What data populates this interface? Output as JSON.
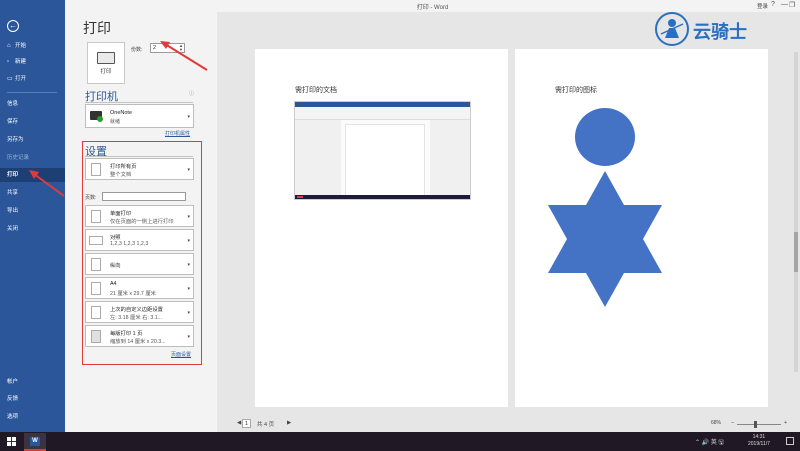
{
  "window": {
    "title": "打印 - Word",
    "login": "登录",
    "controls": [
      "?",
      "—",
      "❐",
      "✕"
    ]
  },
  "sidebar": {
    "back_glyph": "←",
    "items": [
      {
        "label": "开始",
        "icon": "home-icon",
        "glyph": "⌂"
      },
      {
        "label": "新建",
        "icon": "new-doc-icon",
        "glyph": "▫"
      },
      {
        "label": "打开",
        "icon": "open-folder-icon",
        "glyph": "▭"
      },
      {
        "label": "信息"
      },
      {
        "label": "保存"
      },
      {
        "label": "另存为"
      },
      {
        "label": "历史记录"
      },
      {
        "label": "打印"
      },
      {
        "label": "共享"
      },
      {
        "label": "导出"
      },
      {
        "label": "关闭"
      },
      {
        "label": "帐户"
      },
      {
        "label": "反馈"
      },
      {
        "label": "选项"
      }
    ]
  },
  "print": {
    "title": "打印",
    "print_button": "打印",
    "copies_label": "份数:",
    "copies_value": "2",
    "printer_section": "打印机",
    "printer_name": "OneNote",
    "printer_status": "就绪",
    "printer_props_link": "打印机属性",
    "settings_section": "设置",
    "pages_label": "页数:",
    "pages_value": "",
    "settings": [
      {
        "line1": "打印所有页",
        "line2": "整个文档"
      },
      {
        "line1": "单面打印",
        "line2": "仅在页面的一侧上进行打印"
      },
      {
        "line1": "对照",
        "line2": "1,2,3    1,2,3    1,2,3"
      },
      {
        "line1": "纵向",
        "line2": ""
      },
      {
        "line1": "A4",
        "line2": "21 厘米 x 29.7 厘米"
      },
      {
        "line1": "上次的自定义边距设置",
        "line2": "左: 3.18 厘米    右: 3.1..."
      },
      {
        "line1": "每版打印 1 页",
        "line2": "缩放到 14 厘米 x 20.3..."
      }
    ],
    "page_setup_link": "页面设置"
  },
  "preview": {
    "page1_heading": "需打印的文档",
    "page2_heading": "需打印的图标",
    "prev_glyph": "◀",
    "current_page": "1",
    "total": "共 4 页",
    "next_glyph": "▶",
    "zoom": "68%",
    "zoom_minus": "−",
    "zoom_plus": "+"
  },
  "watermark": {
    "text": "云骑士"
  },
  "taskbar": {
    "word_glyph": "W",
    "tray": "⌃  🔊  英  🖫",
    "time": "14:31",
    "date": "2019/11/7"
  },
  "colors": {
    "accent": "#2b579a",
    "highlight": "#e23a3a",
    "shape": "#4472c4"
  }
}
